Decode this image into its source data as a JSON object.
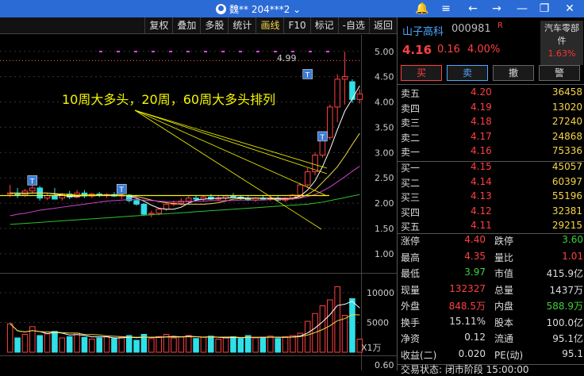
{
  "titlebar": {
    "user": "魏** 204***2 ⌄"
  },
  "toolbar": {
    "items": [
      "复权",
      "叠加",
      "多股",
      "统计",
      "画线",
      "F10",
      "标记",
      "-自选",
      "返回"
    ],
    "active": "画线"
  },
  "chart": {
    "annotation": "10周大多头，20周，60周大多头排列",
    "price_label": "4.99",
    "y_ticks": [
      "5.00",
      "4.50",
      "4.00",
      "3.50",
      "3.00",
      "2.50",
      "2.00",
      "1.50",
      "1.00"
    ],
    "vol_ticks": [
      "10000",
      "5000"
    ],
    "vol_unit": "X1万",
    "bottom_tick": "0.60",
    "colors": {
      "up": "#ff4040",
      "down": "#2fe0e8",
      "ma5": "#ffffff",
      "ma10": "#f5d547",
      "ma20": "#d040d0",
      "ma60": "#30c030",
      "baseline": "#f5f500"
    }
  },
  "chart_data": {
    "type": "candlestick",
    "candles": [
      {
        "o": 2.18,
        "h": 2.36,
        "l": 2.12,
        "c": 2.2
      },
      {
        "o": 2.18,
        "h": 2.3,
        "l": 2.1,
        "c": 2.16
      },
      {
        "o": 2.16,
        "h": 2.28,
        "l": 2.12,
        "c": 2.24
      },
      {
        "o": 2.24,
        "h": 2.4,
        "l": 2.18,
        "c": 2.3
      },
      {
        "o": 2.3,
        "h": 2.34,
        "l": 2.05,
        "c": 2.1
      },
      {
        "o": 2.1,
        "h": 2.2,
        "l": 2.06,
        "c": 2.15
      },
      {
        "o": 2.14,
        "h": 2.3,
        "l": 2.08,
        "c": 2.08
      },
      {
        "o": 2.1,
        "h": 2.2,
        "l": 2.05,
        "c": 2.18
      },
      {
        "o": 2.18,
        "h": 2.24,
        "l": 2.08,
        "c": 2.12
      },
      {
        "o": 2.12,
        "h": 2.26,
        "l": 2.1,
        "c": 2.2
      },
      {
        "o": 2.2,
        "h": 2.26,
        "l": 2.1,
        "c": 2.14
      },
      {
        "o": 2.14,
        "h": 2.2,
        "l": 2.1,
        "c": 2.18
      },
      {
        "o": 2.18,
        "h": 2.22,
        "l": 2.12,
        "c": 2.15
      },
      {
        "o": 2.15,
        "h": 2.2,
        "l": 2.1,
        "c": 2.17
      },
      {
        "o": 2.17,
        "h": 2.22,
        "l": 2.12,
        "c": 2.14
      },
      {
        "o": 2.14,
        "h": 2.2,
        "l": 2.08,
        "c": 2.16
      },
      {
        "o": 2.16,
        "h": 2.18,
        "l": 2.02,
        "c": 2.05
      },
      {
        "o": 2.05,
        "h": 2.1,
        "l": 1.95,
        "c": 1.98
      },
      {
        "o": 1.98,
        "h": 2.0,
        "l": 1.75,
        "c": 1.78
      },
      {
        "o": 1.78,
        "h": 1.85,
        "l": 1.72,
        "c": 1.8
      },
      {
        "o": 1.8,
        "h": 1.9,
        "l": 1.76,
        "c": 1.88
      },
      {
        "o": 1.88,
        "h": 2.0,
        "l": 1.85,
        "c": 1.98
      },
      {
        "o": 1.98,
        "h": 2.05,
        "l": 1.94,
        "c": 2.0
      },
      {
        "o": 2.0,
        "h": 2.1,
        "l": 1.96,
        "c": 2.04
      },
      {
        "o": 2.04,
        "h": 2.14,
        "l": 2.0,
        "c": 2.1
      },
      {
        "o": 2.1,
        "h": 2.16,
        "l": 2.04,
        "c": 2.08
      },
      {
        "o": 2.08,
        "h": 2.14,
        "l": 2.04,
        "c": 2.12
      },
      {
        "o": 2.12,
        "h": 2.18,
        "l": 2.06,
        "c": 2.08
      },
      {
        "o": 2.08,
        "h": 2.14,
        "l": 2.04,
        "c": 2.1
      },
      {
        "o": 2.1,
        "h": 2.16,
        "l": 2.06,
        "c": 2.14
      },
      {
        "o": 2.14,
        "h": 2.2,
        "l": 2.1,
        "c": 2.12
      },
      {
        "o": 2.12,
        "h": 2.16,
        "l": 2.06,
        "c": 2.1
      },
      {
        "o": 2.1,
        "h": 2.14,
        "l": 2.04,
        "c": 2.06
      },
      {
        "o": 2.06,
        "h": 2.12,
        "l": 2.02,
        "c": 2.1
      },
      {
        "o": 2.1,
        "h": 2.16,
        "l": 2.06,
        "c": 2.08
      },
      {
        "o": 2.08,
        "h": 2.12,
        "l": 2.04,
        "c": 2.1
      },
      {
        "o": 2.1,
        "h": 2.14,
        "l": 2.04,
        "c": 2.06
      },
      {
        "o": 2.06,
        "h": 2.12,
        "l": 2.02,
        "c": 2.1
      },
      {
        "o": 2.1,
        "h": 2.18,
        "l": 2.06,
        "c": 2.16
      },
      {
        "o": 2.16,
        "h": 2.4,
        "l": 2.12,
        "c": 2.36
      },
      {
        "o": 2.36,
        "h": 2.7,
        "l": 2.3,
        "c": 2.62
      },
      {
        "o": 2.62,
        "h": 3.0,
        "l": 2.55,
        "c": 2.95
      },
      {
        "o": 2.95,
        "h": 3.4,
        "l": 2.9,
        "c": 3.3
      },
      {
        "o": 3.3,
        "h": 3.95,
        "l": 3.25,
        "c": 3.9
      },
      {
        "o": 3.9,
        "h": 4.55,
        "l": 3.6,
        "c": 4.45
      },
      {
        "o": 4.45,
        "h": 4.99,
        "l": 3.95,
        "c": 4.5
      },
      {
        "o": 4.4,
        "h": 4.45,
        "l": 3.98,
        "c": 4.05
      },
      {
        "o": 4.05,
        "h": 4.25,
        "l": 3.97,
        "c": 4.16
      }
    ],
    "volumes": [
      4800,
      2400,
      3000,
      4300,
      2800,
      3100,
      3500,
      2400,
      2600,
      3200,
      2500,
      2200,
      2400,
      2600,
      2300,
      2500,
      2800,
      2000,
      3000,
      2300,
      2600,
      3000,
      2400,
      2600,
      2800,
      2300,
      2500,
      2700,
      2200,
      2400,
      2600,
      2300,
      2800,
      2400,
      2500,
      2700,
      2300,
      2600,
      2800,
      3200,
      5200,
      6500,
      7800,
      8800,
      11000,
      6200,
      9000,
      2200
    ],
    "ma_series": [
      {
        "name": "ma5",
        "values": [
          2.2,
          2.2,
          2.19,
          2.2,
          2.2,
          2.2,
          2.18,
          2.16,
          2.13,
          2.13,
          2.16,
          2.16,
          2.16,
          2.16,
          2.16,
          2.16,
          2.14,
          2.1,
          2.04,
          1.96,
          1.9,
          1.88,
          1.88,
          1.92,
          2.0,
          2.06,
          2.08,
          2.09,
          2.1,
          2.1,
          2.11,
          2.11,
          2.1,
          2.1,
          2.1,
          2.09,
          2.08,
          2.08,
          2.1,
          2.14,
          2.26,
          2.44,
          2.72,
          3.06,
          3.45,
          3.82,
          4.06,
          4.32
        ]
      },
      {
        "name": "ma10",
        "values": [
          2.2,
          2.2,
          2.2,
          2.2,
          2.2,
          2.2,
          2.19,
          2.18,
          2.17,
          2.16,
          2.16,
          2.16,
          2.15,
          2.15,
          2.15,
          2.15,
          2.15,
          2.13,
          2.1,
          2.06,
          2.03,
          2.01,
          1.99,
          1.98,
          1.98,
          1.98,
          1.98,
          1.99,
          2.01,
          2.04,
          2.08,
          2.09,
          2.09,
          2.1,
          2.1,
          2.1,
          2.1,
          2.09,
          2.1,
          2.11,
          2.17,
          2.26,
          2.41,
          2.56,
          2.72,
          2.93,
          3.16,
          3.38
        ]
      },
      {
        "name": "ma20",
        "values": [
          1.75,
          1.78,
          1.8,
          1.83,
          1.86,
          1.88,
          1.9,
          1.92,
          1.94,
          1.96,
          1.98,
          2.0,
          2.02,
          2.04,
          2.05,
          2.06,
          2.07,
          2.07,
          2.06,
          2.05,
          2.04,
          2.03,
          2.03,
          2.03,
          2.03,
          2.04,
          2.04,
          2.05,
          2.05,
          2.05,
          2.05,
          2.06,
          2.06,
          2.06,
          2.06,
          2.07,
          2.07,
          2.07,
          2.08,
          2.1,
          2.13,
          2.17,
          2.24,
          2.32,
          2.42,
          2.52,
          2.63,
          2.73
        ]
      },
      {
        "name": "ma60",
        "values": [
          1.58,
          1.59,
          1.6,
          1.61,
          1.62,
          1.63,
          1.64,
          1.65,
          1.66,
          1.67,
          1.68,
          1.69,
          1.7,
          1.71,
          1.72,
          1.73,
          1.74,
          1.75,
          1.76,
          1.77,
          1.78,
          1.79,
          1.8,
          1.81,
          1.82,
          1.83,
          1.84,
          1.85,
          1.86,
          1.87,
          1.88,
          1.89,
          1.9,
          1.91,
          1.92,
          1.93,
          1.94,
          1.95,
          1.96,
          1.97,
          1.98,
          2.0,
          2.02,
          2.05,
          2.08,
          2.11,
          2.14,
          2.17
        ]
      }
    ],
    "baseline": 2.15,
    "ylim": [
      0.7,
      5.2
    ]
  },
  "quote": {
    "name": "山子高科",
    "code": "000981",
    "r": "R",
    "sector": "汽车零部件",
    "sector_pct": "1.63%",
    "price": "4.16",
    "chg": "0.16",
    "pct": "4.00%",
    "buttons": [
      "买",
      "卖",
      "撤",
      "警"
    ],
    "asks": [
      [
        "卖五",
        "4.20",
        "36458"
      ],
      [
        "卖四",
        "4.19",
        "13020"
      ],
      [
        "卖三",
        "4.18",
        "27240"
      ],
      [
        "卖二",
        "4.17",
        "24868"
      ],
      [
        "卖一",
        "4.16",
        "75336"
      ]
    ],
    "bids": [
      [
        "买一",
        "4.15",
        "45057"
      ],
      [
        "买二",
        "4.14",
        "60397"
      ],
      [
        "买三",
        "4.13",
        "55196"
      ],
      [
        "买四",
        "4.12",
        "32381"
      ],
      [
        "买五",
        "4.11",
        "29215"
      ]
    ],
    "stats": [
      [
        "涨停",
        "4.40",
        "red",
        "跌停",
        "3.60",
        "grn"
      ],
      [
        "最高",
        "4.35",
        "red",
        "量比",
        "1.01",
        "red"
      ],
      [
        "最低",
        "3.97",
        "grn",
        "市值",
        "415.9亿",
        "wht"
      ],
      [
        "现量",
        "132327",
        "red",
        "总量",
        "1437万",
        "wht"
      ],
      [
        "外盘",
        "848.5万",
        "red",
        "内盘",
        "588.9万",
        "grn"
      ],
      [
        "换手",
        "15.11%",
        "wht",
        "股本",
        "100.0亿",
        "wht"
      ],
      [
        "净资",
        "0.12",
        "wht",
        "流通",
        "95.1亿",
        "wht"
      ],
      [
        "收益(二)",
        "0.020",
        "wht",
        "PE(动)",
        "95.1",
        "wht"
      ]
    ],
    "status": "交易状态: 闭市阶段 15:00:00"
  }
}
